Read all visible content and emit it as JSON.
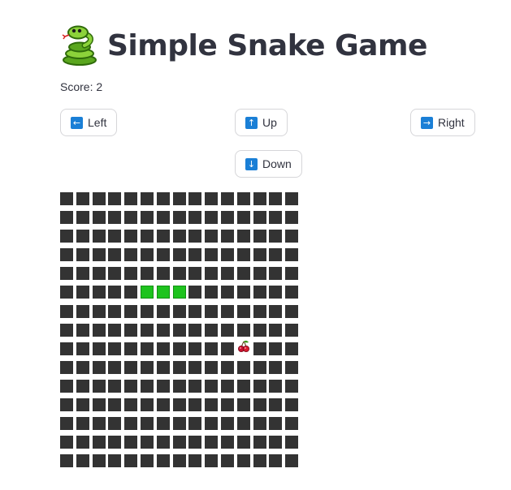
{
  "header": {
    "title": "Simple Snake Game",
    "icon": "snake-icon"
  },
  "score": {
    "text": "Score: 2"
  },
  "controls": {
    "left": {
      "label": "Left",
      "icon": "left-arrow-icon",
      "glyph": "←"
    },
    "up": {
      "label": "Up",
      "icon": "up-arrow-icon",
      "glyph": "↑"
    },
    "right": {
      "label": "Right",
      "icon": "right-arrow-icon",
      "glyph": "→"
    },
    "down": {
      "label": "Down",
      "icon": "down-arrow-icon",
      "glyph": "↓"
    }
  },
  "board": {
    "rows": 15,
    "cols": 15,
    "snake": [
      [
        5,
        5
      ],
      [
        5,
        6
      ],
      [
        5,
        7
      ]
    ],
    "food": [
      8,
      11
    ],
    "food_icon": "cherry-icon",
    "colors": {
      "empty": "#333333",
      "snake": "#1ec31e",
      "food_bg": "#ffffff"
    }
  }
}
